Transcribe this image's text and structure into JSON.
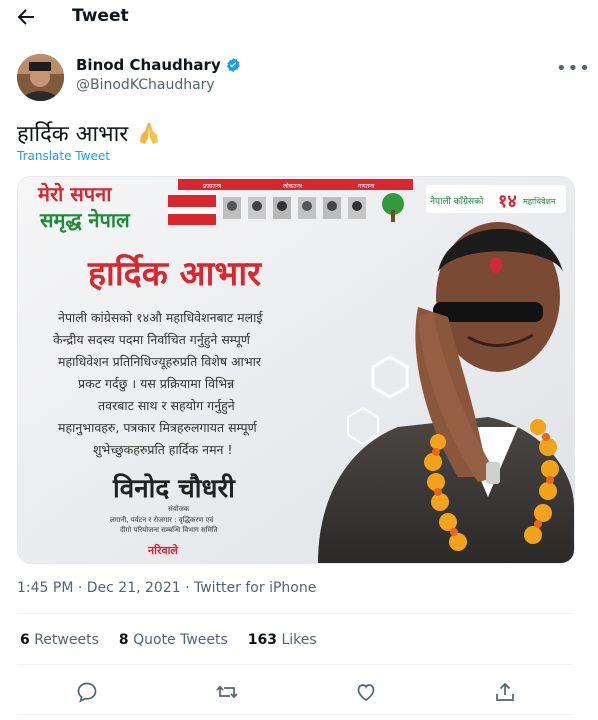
{
  "header": {
    "title": "Tweet"
  },
  "author": {
    "name": "Binod Chaudhary",
    "handle": "@BinodKChaudhary"
  },
  "tweet": {
    "text": "हार्दिक आभार",
    "translate_label": "Translate Tweet"
  },
  "poster": {
    "slogan_line1": "मेरो सपना",
    "slogan_line2": "समृद्ध नेपाल",
    "top_banner": [
      "प्रजातन्त्र",
      "लोकतन्त्र",
      "गणतन्त्र"
    ],
    "right_label": "नेपाली काँग्रेसको",
    "right_label2": "महाधिवेशन",
    "right_number": "१४",
    "headline": "हार्दिक आभार",
    "body_lines": [
      "नेपाली कांग्रेसको १४औ महाधिवेशनबाट मलाई",
      "केन्द्रीय सदस्य पदमा निर्वाचित गर्नुहुने सम्पूर्ण",
      "महाधिवेशन प्रतिनिधिज्यूहरुप्रति विशेष आभार",
      "प्रकट गर्दछु । यस प्रक्रियामा विभिन्न",
      "तवरबाट साथ र सहयोग गर्नुहुने",
      "महानुभावहरु, पत्रकार मित्रहरुलगायत सम्पूर्ण",
      "शुभेच्छुकहरुप्रति हार्दिक नमन !"
    ],
    "signature_name": "विनोद चौधरी",
    "signature_title": "संयोजक",
    "signature_sub1": "लगानी, पर्यटन र रोजगार : वृद्धिकरण एवं",
    "signature_sub2": "दीगो परियोजना सम्बन्धि विभाग समिति",
    "footer_logo": "नरिवाले"
  },
  "meta": {
    "time": "1:45 PM · Dec 21, 2021 · Twitter for iPhone"
  },
  "stats": {
    "retweets_count": "6",
    "retweets_label": "Retweets",
    "quotes_count": "8",
    "quotes_label": "Quote Tweets",
    "likes_count": "163",
    "likes_label": "Likes"
  },
  "icons": [
    "back-arrow-icon",
    "verified-badge-icon",
    "more-icon",
    "folded-hands-icon",
    "reply-icon",
    "retweet-icon",
    "like-icon",
    "share-icon"
  ],
  "colors": {
    "accent": "#1d9bf0",
    "text": "#0f1419",
    "secondary": "#536471",
    "poster_red": "#d7282f",
    "poster_green": "#1f8a3a"
  }
}
